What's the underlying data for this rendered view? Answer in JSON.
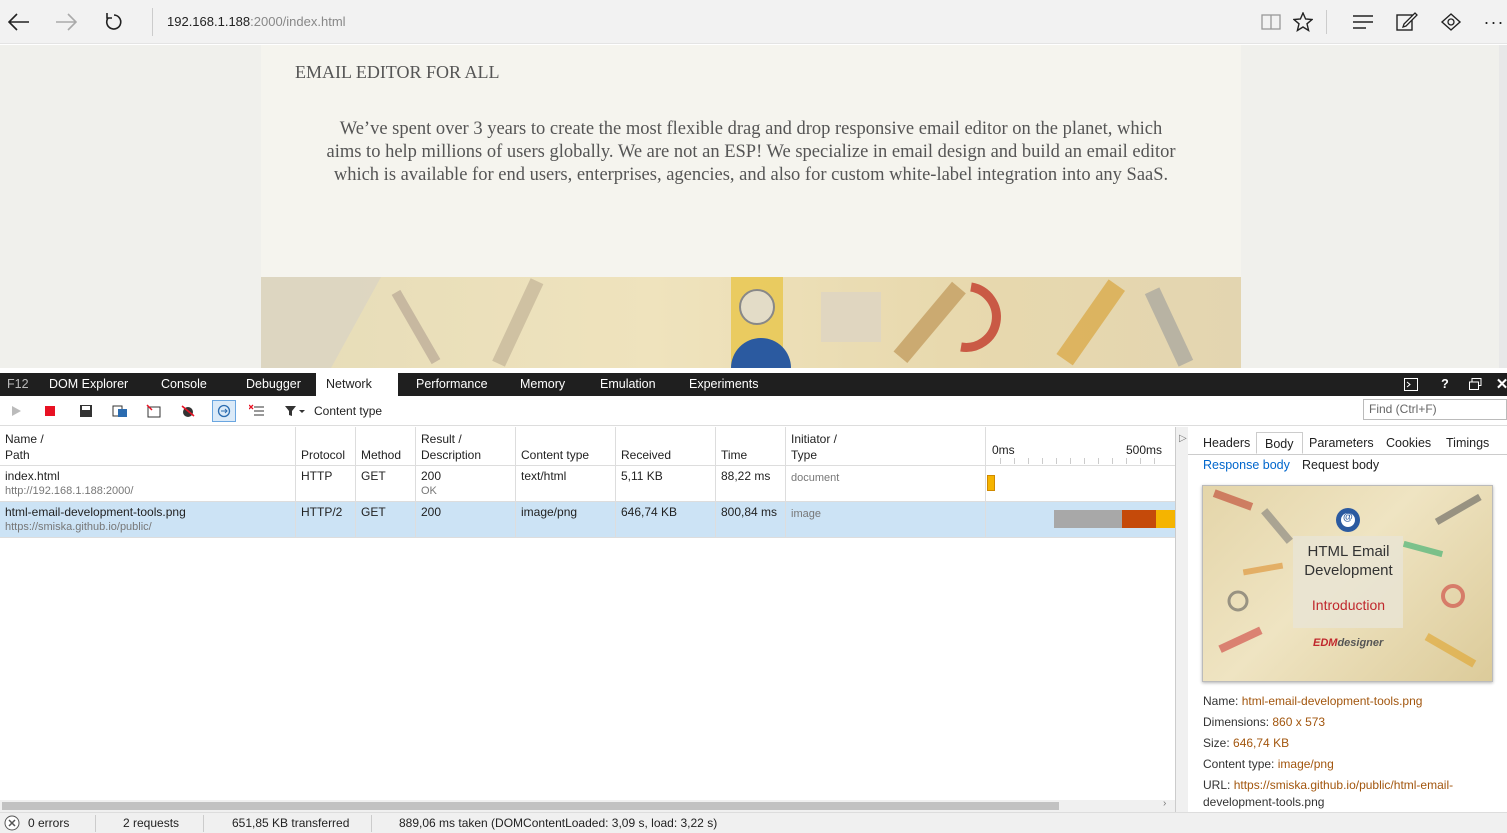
{
  "browser": {
    "address_host": "192.168.1.188",
    "address_rest": ":2000/index.html"
  },
  "webpage": {
    "heading": "EMAIL EDITOR FOR ALL",
    "body": "We’ve spent over 3 years to create the most flexible drag and drop responsive email editor on the planet, which aims to help millions of users globally. We are not an ESP! We specialize in email design and build an email editor which is available for end users, enterprises, agencies, and also for custom white-label integration into any SaaS."
  },
  "devtools": {
    "f12_label": "F12",
    "tabs": [
      "DOM Explorer",
      "Console",
      "Debugger",
      "Network",
      "Performance",
      "Memory",
      "Emulation",
      "Experiments"
    ],
    "active_tab": "Network",
    "filter_label": "Content type",
    "find_placeholder": "Find (Ctrl+F)"
  },
  "grid": {
    "headers": {
      "name": "Name /",
      "path": "Path",
      "protocol": "Protocol",
      "method": "Method",
      "result": "Result /",
      "description": "Description",
      "content_type": "Content type",
      "received": "Received",
      "time": "Time",
      "initiator": "Initiator /",
      "type": "Type",
      "t0": "0ms",
      "t500": "500ms"
    },
    "rows": [
      {
        "name": "index.html",
        "path": "http://192.168.1.188:2000/",
        "protocol": "HTTP",
        "method": "GET",
        "result": "200",
        "description": "OK",
        "content_type": "text/html",
        "received": "5,11 KB",
        "time": "88,22 ms",
        "type": "document"
      },
      {
        "name": "html-email-development-tools.png",
        "path": "https://smiska.github.io/public/",
        "protocol": "HTTP/2",
        "method": "GET",
        "result": "200",
        "description": "",
        "content_type": "image/png",
        "received": "646,74 KB",
        "time": "800,84 ms",
        "type": "image"
      }
    ]
  },
  "details": {
    "tabs": [
      "Headers",
      "Body",
      "Parameters",
      "Cookies",
      "Timings"
    ],
    "active_tab": "Body",
    "subtabs": [
      "Response body",
      "Request body"
    ],
    "preview": {
      "line1": "HTML Email",
      "line2": "Development",
      "line3": "Introduction",
      "logo_a": "EDM",
      "logo_b": "designer"
    },
    "name_label": "Name:",
    "name_value": "html-email-development-tools.png",
    "dims_label": "Dimensions:",
    "dims_value": "860 x 573",
    "size_label": "Size:",
    "size_value": "646,74 KB",
    "ctype_label": "Content type:",
    "ctype_value": "image/png",
    "url_label": "URL:",
    "url_value_1": "https://smiska.github.io/public/html-email-",
    "url_value_2": "development-tools.png"
  },
  "status": {
    "errors": "0 errors",
    "requests": "2 requests",
    "transferred": "651,85 KB transferred",
    "taken": "889,06 ms taken (DOMContentLoaded: 3,09 s, load: 3,22 s)"
  },
  "colors": {
    "accent": "#0078d7",
    "waterfall_wait": "#a8a8a8",
    "waterfall_dl": "#c54a0a",
    "waterfall_recv": "#f5b400",
    "selected_row": "#cce3f5"
  }
}
